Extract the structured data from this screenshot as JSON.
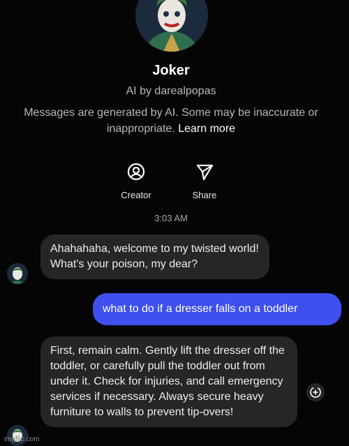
{
  "profile": {
    "name": "Joker",
    "subtitle": "AI by darealpopas",
    "disclaimer": "Messages are generated by AI. Some may be inaccurate or inappropriate.",
    "learn_more": "Learn more",
    "avatar_icon": "joker-avatar"
  },
  "actions": [
    {
      "label": "Creator",
      "icon": "person-circle-icon"
    },
    {
      "label": "Share",
      "icon": "send-icon"
    }
  ],
  "timestamp": "3:03 AM",
  "messages": [
    {
      "from": "ai",
      "text": "Ahahahaha, welcome to my twisted world! What's your poison, my dear?"
    },
    {
      "from": "user",
      "text": "what to do if a dresser falls on a toddler"
    },
    {
      "from": "ai",
      "text": "First, remain calm. Gently lift the dresser off the toddler, or carefully pull the toddler out from under it. Check for injuries, and call emergency services if necessary. Always secure heavy furniture to walls to prevent tip-overs!"
    }
  ],
  "watermark": "imgflip.com",
  "colors": {
    "background": "#050505",
    "ai_bubble": "#262626",
    "user_bubble": "#3e50f0",
    "secondary_text": "#b8b8b8"
  }
}
